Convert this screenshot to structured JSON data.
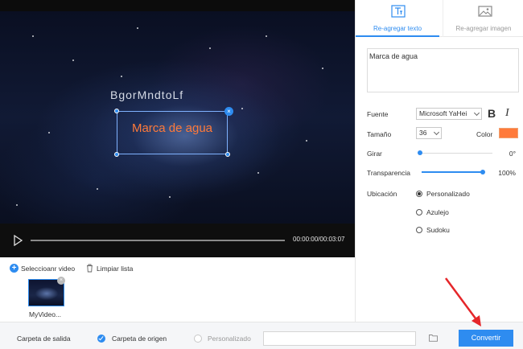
{
  "player": {
    "video_title_text": "BgorMndtoLf",
    "watermark_preview": "Marca de agua",
    "timecode": "00:00:00/00:03:07"
  },
  "tabs": [
    {
      "label": "Re-agregar texto",
      "icon": "text-icon",
      "active": true
    },
    {
      "label": "Re-agregar imagen",
      "icon": "image-icon",
      "active": false
    }
  ],
  "text_settings": {
    "text_value": "Marca de agua",
    "font_label": "Fuente",
    "font_value": "Microsoft YaHei",
    "bold_label": "B",
    "italic_label": "I",
    "size_label": "Tamaño",
    "size_value": "36",
    "color_label": "Color",
    "color_value": "#ff7a3a",
    "rotate_label": "Girar",
    "rotate_value": "0°",
    "rotate_fraction": 0,
    "transparency_label": "Transparencia",
    "transparency_value": "100%",
    "transparency_fraction": 1,
    "location_label": "Ubicación",
    "location_options": [
      {
        "label": "Personalizado",
        "checked": true
      },
      {
        "label": "Azulejo",
        "checked": false
      },
      {
        "label": "Sudoku",
        "checked": false
      }
    ]
  },
  "file_list": {
    "add_label": "Seleccioanr video",
    "clear_label": "Limpiar lista",
    "items": [
      {
        "name": "MyVideo..."
      }
    ]
  },
  "footer": {
    "output_label": "Carpeta de salida",
    "origin_label": "Carpeta de origen",
    "custom_label": "Personalizado",
    "path_value": "",
    "convert_label": "Convertir"
  },
  "colors": {
    "accent": "#2e8cf0",
    "watermark": "#ff7a3a",
    "annotation_arrow": "#e5262a"
  }
}
